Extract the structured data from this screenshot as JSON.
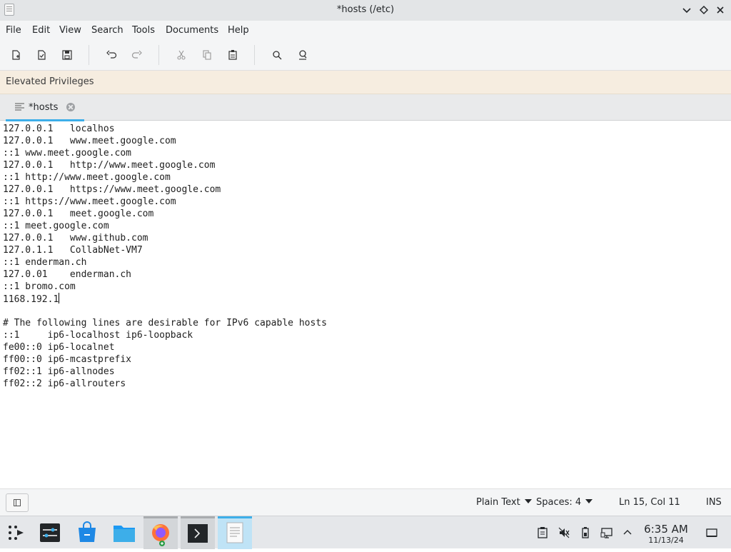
{
  "window": {
    "title": "*hosts (/etc)"
  },
  "menubar": {
    "items": [
      "File",
      "Edit",
      "View",
      "Search",
      "Tools",
      "Documents",
      "Help"
    ]
  },
  "toolbar": {
    "buttons": [
      "new-document",
      "open-document",
      "save-document",
      "undo",
      "redo",
      "cut",
      "copy",
      "paste",
      "find",
      "find-replace"
    ]
  },
  "banner": {
    "text": "Elevated Privileges"
  },
  "tabs": [
    {
      "label": "*hosts"
    }
  ],
  "editor": {
    "lines": [
      "127.0.0.1   localhos",
      "127.0.0.1   www.meet.google.com",
      "::1 www.meet.google.com",
      "127.0.0.1   http://www.meet.google.com",
      "::1 http://www.meet.google.com",
      "127.0.0.1   https://www.meet.google.com",
      "::1 https://www.meet.google.com",
      "127.0.0.1   meet.google.com",
      "::1 meet.google.com",
      "127.0.0.1   www.github.com",
      "127.0.1.1   CollabNet-VM7",
      "::1 enderman.ch",
      "127.0.01    enderman.ch",
      "::1 bromo.com",
      "1168.192.1",
      "",
      "# The following lines are desirable for IPv6 capable hosts",
      "::1     ip6-localhost ip6-loopback",
      "fe00::0 ip6-localnet",
      "ff00::0 ip6-mcastprefix",
      "ff02::1 ip6-allnodes",
      "ff02::2 ip6-allrouters"
    ],
    "cursor_line": 15
  },
  "statusbar": {
    "syntax": "Plain Text",
    "indent": "Spaces: 4",
    "position": "Ln 15, Col 11",
    "mode": "INS"
  },
  "taskbar": {
    "apps": [
      "launcher",
      "system-settings",
      "discover",
      "file-manager",
      "firefox",
      "terminal",
      "text-editor"
    ],
    "clock": {
      "time": "6:35 AM",
      "date": "11/13/24"
    }
  }
}
